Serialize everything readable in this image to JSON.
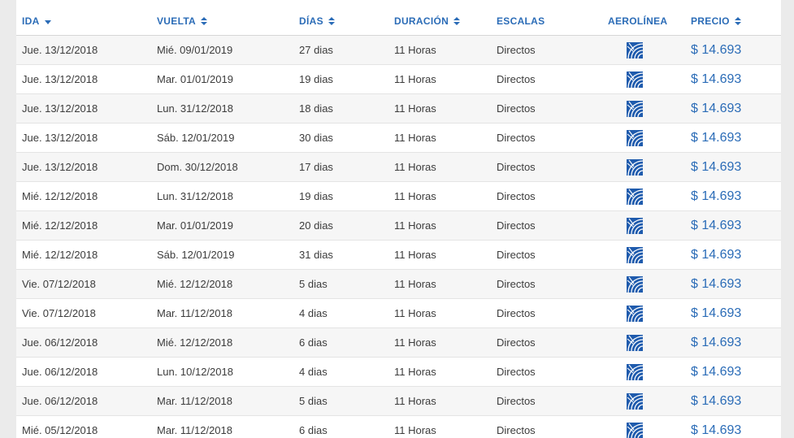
{
  "headers": {
    "ida": "IDA",
    "vuelta": "VUELTA",
    "dias": "DÍAS",
    "duracion": "DURACIÓN",
    "escalas": "ESCALAS",
    "aerolinea": "AEROLÍNEA",
    "precio": "PRECIO"
  },
  "colors": {
    "accent": "#2b6cb7",
    "logo_blue": "#1f5bad",
    "row_alt": "#f6f6f6"
  },
  "rows": [
    {
      "ida": "Jue. 13/12/2018",
      "vuelta": "Mié. 09/01/2019",
      "dias": "27 dias",
      "duracion": "11 Horas",
      "escalas": "Directos",
      "airline_icon": "united-airlines-logo-icon",
      "precio": "$ 14.693"
    },
    {
      "ida": "Jue. 13/12/2018",
      "vuelta": "Mar. 01/01/2019",
      "dias": "19 dias",
      "duracion": "11 Horas",
      "escalas": "Directos",
      "airline_icon": "united-airlines-logo-icon",
      "precio": "$ 14.693"
    },
    {
      "ida": "Jue. 13/12/2018",
      "vuelta": "Lun. 31/12/2018",
      "dias": "18 dias",
      "duracion": "11 Horas",
      "escalas": "Directos",
      "airline_icon": "united-airlines-logo-icon",
      "precio": "$ 14.693"
    },
    {
      "ida": "Jue. 13/12/2018",
      "vuelta": "Sáb. 12/01/2019",
      "dias": "30 dias",
      "duracion": "11 Horas",
      "escalas": "Directos",
      "airline_icon": "united-airlines-logo-icon",
      "precio": "$ 14.693"
    },
    {
      "ida": "Jue. 13/12/2018",
      "vuelta": "Dom. 30/12/2018",
      "dias": "17 dias",
      "duracion": "11 Horas",
      "escalas": "Directos",
      "airline_icon": "united-airlines-logo-icon",
      "precio": "$ 14.693"
    },
    {
      "ida": "Mié. 12/12/2018",
      "vuelta": "Lun. 31/12/2018",
      "dias": "19 dias",
      "duracion": "11 Horas",
      "escalas": "Directos",
      "airline_icon": "united-airlines-logo-icon",
      "precio": "$ 14.693"
    },
    {
      "ida": "Mié. 12/12/2018",
      "vuelta": "Mar. 01/01/2019",
      "dias": "20 dias",
      "duracion": "11 Horas",
      "escalas": "Directos",
      "airline_icon": "united-airlines-logo-icon",
      "precio": "$ 14.693"
    },
    {
      "ida": "Mié. 12/12/2018",
      "vuelta": "Sáb. 12/01/2019",
      "dias": "31 dias",
      "duracion": "11 Horas",
      "escalas": "Directos",
      "airline_icon": "united-airlines-logo-icon",
      "precio": "$ 14.693"
    },
    {
      "ida": "Vie. 07/12/2018",
      "vuelta": "Mié. 12/12/2018",
      "dias": "5 dias",
      "duracion": "11 Horas",
      "escalas": "Directos",
      "airline_icon": "united-airlines-logo-icon",
      "precio": "$ 14.693"
    },
    {
      "ida": "Vie. 07/12/2018",
      "vuelta": "Mar. 11/12/2018",
      "dias": "4 dias",
      "duracion": "11 Horas",
      "escalas": "Directos",
      "airline_icon": "united-airlines-logo-icon",
      "precio": "$ 14.693"
    },
    {
      "ida": "Jue. 06/12/2018",
      "vuelta": "Mié. 12/12/2018",
      "dias": "6 dias",
      "duracion": "11 Horas",
      "escalas": "Directos",
      "airline_icon": "united-airlines-logo-icon",
      "precio": "$ 14.693"
    },
    {
      "ida": "Jue. 06/12/2018",
      "vuelta": "Lun. 10/12/2018",
      "dias": "4 dias",
      "duracion": "11 Horas",
      "escalas": "Directos",
      "airline_icon": "united-airlines-logo-icon",
      "precio": "$ 14.693"
    },
    {
      "ida": "Jue. 06/12/2018",
      "vuelta": "Mar. 11/12/2018",
      "dias": "5 dias",
      "duracion": "11 Horas",
      "escalas": "Directos",
      "airline_icon": "united-airlines-logo-icon",
      "precio": "$ 14.693"
    },
    {
      "ida": "Mié. 05/12/2018",
      "vuelta": "Mar. 11/12/2018",
      "dias": "6 dias",
      "duracion": "11 Horas",
      "escalas": "Directos",
      "airline_icon": "united-airlines-logo-icon",
      "precio": "$ 14.693"
    }
  ]
}
